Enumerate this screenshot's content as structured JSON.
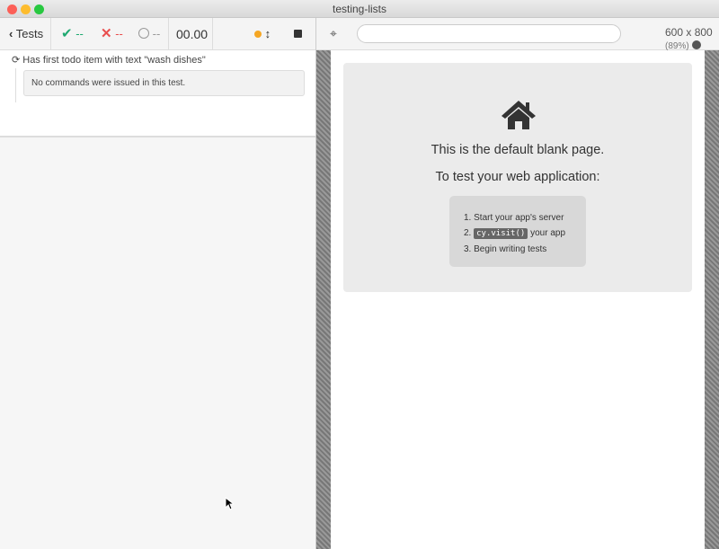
{
  "window": {
    "title": "testing-lists"
  },
  "toolbar": {
    "back_label": "Tests",
    "passed": "--",
    "failed": "--",
    "pending": "--",
    "duration": "00.00"
  },
  "test": {
    "title": "Has first todo item with text \"wash dishes\"",
    "message": "No commands were issued in this test."
  },
  "aut_toolbar": {
    "url": "",
    "viewport": "600 x 800",
    "scale": "(89%)"
  },
  "blank_page": {
    "heading": "This is the default blank page.",
    "subheading": "To test your web application:",
    "steps": [
      "Start your app's server",
      "your app",
      "Begin writing tests"
    ],
    "code": "cy.visit()"
  },
  "colors": {
    "pass": "#1fa971",
    "fail": "#e94f4f",
    "indicator": "#f5a623"
  }
}
